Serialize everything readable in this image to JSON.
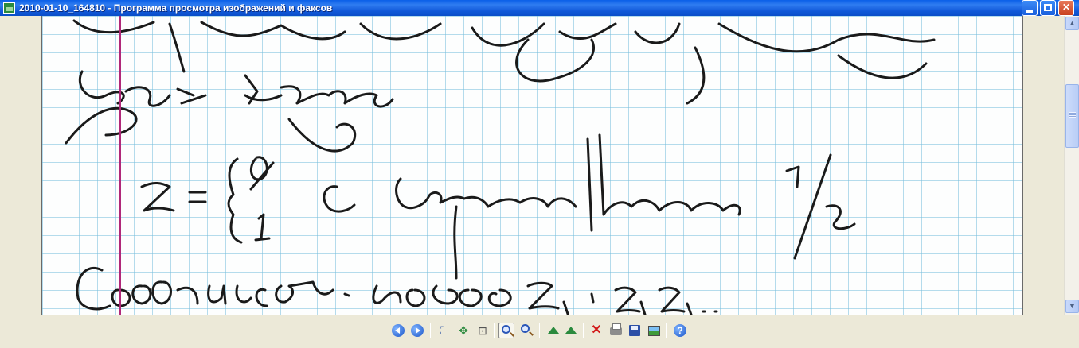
{
  "window": {
    "title": "2010-01-10_164810 - Программа просмотра изображений и факсов",
    "app_icon": "image-viewer-icon",
    "controls": {
      "minimize": "minimize-icon",
      "maximize": "maximize-icon",
      "close": "close-icon"
    }
  },
  "viewer": {
    "image": "handwritten-notebook-page",
    "paper": {
      "grid_color": "#78bedc",
      "margin_line_color": "#b0287a",
      "ink_color": "#1a1a1a"
    }
  },
  "scrollbar": {
    "up": "▲",
    "down": "▼"
  },
  "toolbar": {
    "buttons": [
      {
        "name": "previous-image-button",
        "icon": "previous-icon"
      },
      {
        "name": "next-image-button",
        "icon": "next-icon"
      },
      {
        "name": "best-fit-button",
        "icon": "best-fit-icon"
      },
      {
        "name": "actual-size-button",
        "icon": "actual-size-icon"
      },
      {
        "name": "slideshow-button",
        "icon": "slideshow-icon"
      },
      {
        "name": "zoom-in-button",
        "icon": "zoom-in-icon"
      },
      {
        "name": "zoom-out-button",
        "icon": "zoom-out-icon"
      },
      {
        "name": "rotate-clockwise-button",
        "icon": "rotate-clockwise-icon"
      },
      {
        "name": "rotate-counterclockwise-button",
        "icon": "rotate-counterclockwise-icon"
      },
      {
        "name": "delete-button",
        "icon": "delete-icon"
      },
      {
        "name": "print-button",
        "icon": "print-icon"
      },
      {
        "name": "save-button",
        "icon": "save-icon"
      },
      {
        "name": "edit-image-button",
        "icon": "edit-image-icon"
      },
      {
        "name": "help-button",
        "icon": "help-icon"
      }
    ]
  }
}
